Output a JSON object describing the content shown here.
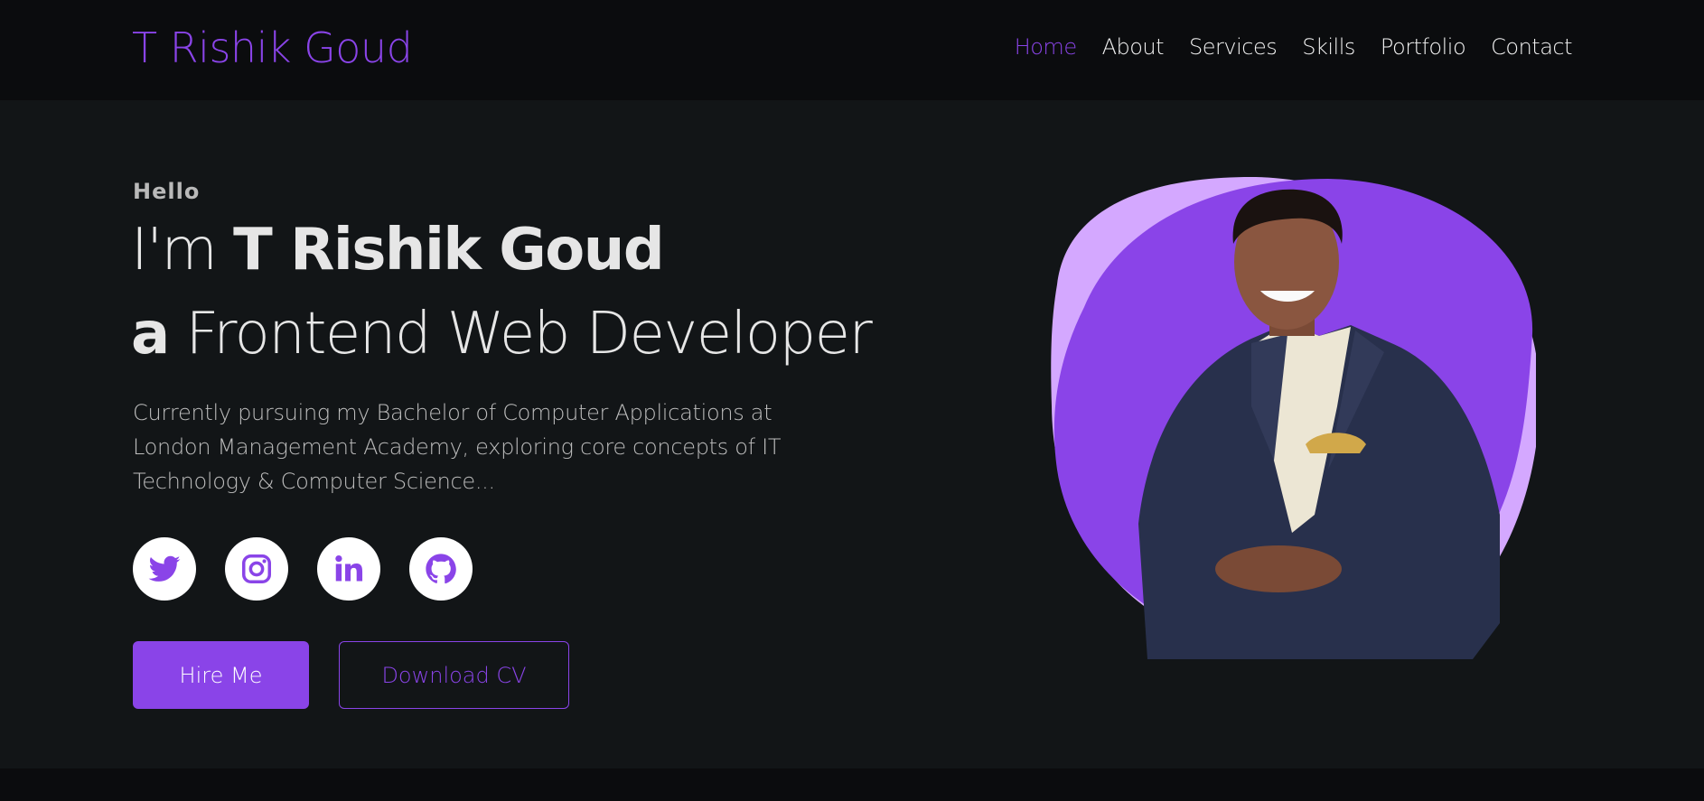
{
  "header": {
    "logo": "T Rishik Goud",
    "nav": [
      {
        "label": "Home",
        "active": true
      },
      {
        "label": "About"
      },
      {
        "label": "Services"
      },
      {
        "label": "Skills"
      },
      {
        "label": "Portfolio"
      },
      {
        "label": "Contact"
      }
    ]
  },
  "hero": {
    "greeting": "Hello",
    "intro_prefix": "I'm",
    "name": "T Rishik Goud",
    "article": "a",
    "role": "Frontend Web Developer",
    "description": "Currently pursuing my Bachelor of Computer Applications at London Management Academy, exploring core concepts of IT Technology & Computer Science...",
    "socials": [
      {
        "icon": "twitter-icon"
      },
      {
        "icon": "instagram-icon"
      },
      {
        "icon": "linkedin-icon"
      },
      {
        "icon": "github-icon"
      }
    ],
    "primary_button": "Hire Me",
    "secondary_button": "Download CV"
  },
  "colors": {
    "accent": "#8a44e8",
    "accent_light": "#d4a8ff",
    "background": "#121517",
    "header_bg": "#0b0c0e"
  }
}
